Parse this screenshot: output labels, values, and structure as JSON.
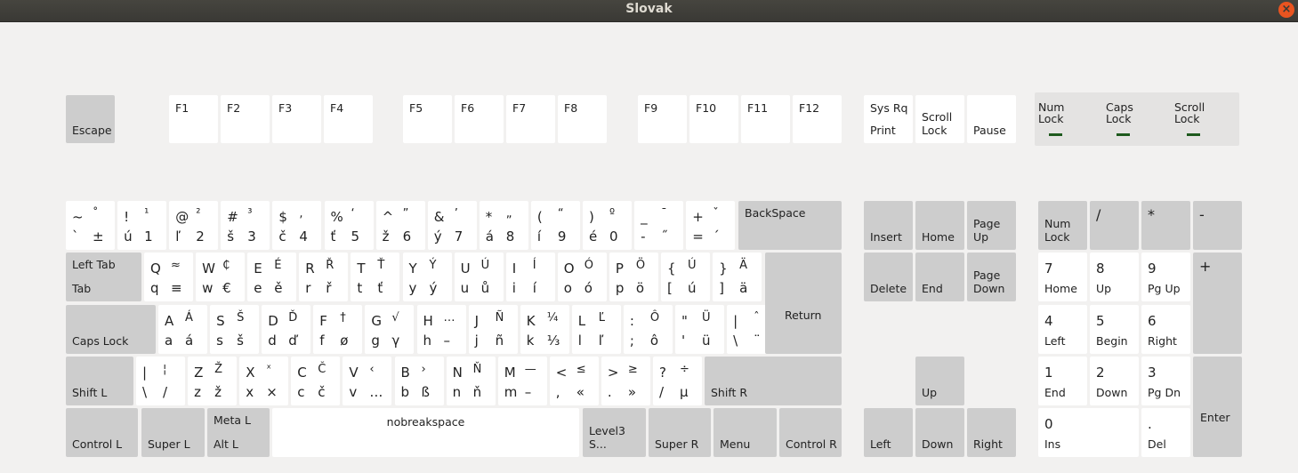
{
  "window": {
    "title": "Slovak",
    "close_glyph": "×"
  },
  "function_row": {
    "escape": "Escape",
    "f": [
      "F1",
      "F2",
      "F3",
      "F4",
      "F5",
      "F6",
      "F7",
      "F8",
      "F9",
      "F10",
      "F11",
      "F12"
    ],
    "sysrq": [
      "Sys Rq",
      "Print"
    ],
    "scroll_lock": "Scroll\nLock",
    "pause": "Pause"
  },
  "indicators": [
    {
      "label": "Num\nLock"
    },
    {
      "label": "Caps\nLock"
    },
    {
      "label": "Scroll\nLock"
    }
  ],
  "number_row": {
    "chars": [
      [
        "~",
        "˚",
        "`",
        "±"
      ],
      [
        "!",
        "¹",
        "ú",
        "1"
      ],
      [
        "@",
        "²",
        "ľ",
        "2"
      ],
      [
        "#",
        "³",
        "š",
        "3"
      ],
      [
        "$",
        ",",
        "č",
        "4"
      ],
      [
        "%",
        "‘",
        "ť",
        "5"
      ],
      [
        "^",
        "”",
        "ž",
        "6"
      ],
      [
        "&",
        "’",
        "ý",
        "7"
      ],
      [
        "*",
        "„",
        "á",
        "8"
      ],
      [
        "(",
        "“",
        "í",
        "9"
      ],
      [
        ")",
        "º",
        "é",
        "0"
      ],
      [
        "_",
        "¯",
        "-",
        "˝"
      ],
      [
        "+",
        "ˇ",
        "=",
        "´"
      ]
    ],
    "backspace": "BackSpace"
  },
  "q_row": {
    "tab": [
      "Left Tab",
      "Tab"
    ],
    "chars": [
      [
        "Q",
        "≈",
        "q",
        "≡"
      ],
      [
        "W",
        "₵",
        "w",
        "€"
      ],
      [
        "E",
        "É",
        "e",
        "ě"
      ],
      [
        "R",
        "Ř",
        "r",
        "ř"
      ],
      [
        "T",
        "Ť",
        "t",
        "ť"
      ],
      [
        "Y",
        "Ý",
        "y",
        "ý"
      ],
      [
        "U",
        "Ú",
        "u",
        "ů"
      ],
      [
        "I",
        "Í",
        "i",
        "í"
      ],
      [
        "O",
        "Ó",
        "o",
        "ó"
      ],
      [
        "P",
        "Ö",
        "p",
        "ö"
      ],
      [
        "{",
        "Ú",
        "[",
        "ú"
      ],
      [
        "}",
        "Ä",
        "]",
        "ä"
      ]
    ],
    "return": "Return"
  },
  "a_row": {
    "caps": "Caps Lock",
    "chars": [
      [
        "A",
        "Á",
        "a",
        "á"
      ],
      [
        "S",
        "Š",
        "s",
        "š"
      ],
      [
        "D",
        "Ď",
        "d",
        "ď"
      ],
      [
        "F",
        "†",
        "f",
        "ø"
      ],
      [
        "G",
        "√",
        "g",
        "γ"
      ],
      [
        "H",
        "…",
        "h",
        "–"
      ],
      [
        "J",
        "Ñ",
        "j",
        "ñ"
      ],
      [
        "K",
        "¼",
        "k",
        "⅓"
      ],
      [
        "L",
        "Ľ",
        "l",
        "ľ"
      ],
      [
        ":",
        "Ô",
        ";",
        "ô"
      ],
      [
        "\"",
        "Ü",
        "'",
        "ü"
      ],
      [
        "|",
        "ˆ",
        "\\",
        "¨"
      ]
    ]
  },
  "z_row": {
    "shift_l": "Shift L",
    "chars": [
      [
        "|",
        "¦",
        "\\",
        "/"
      ],
      [
        "Z",
        "Ž",
        "z",
        "ž"
      ],
      [
        "X",
        "ˣ",
        "x",
        "×"
      ],
      [
        "C",
        "Č",
        "c",
        "č"
      ],
      [
        "V",
        "‹",
        "v",
        "…"
      ],
      [
        "B",
        "›",
        "b",
        "ß"
      ],
      [
        "N",
        "Ň",
        "n",
        "ň"
      ],
      [
        "M",
        "—",
        "m",
        "–"
      ],
      [
        "<",
        "≤",
        ",",
        "«"
      ],
      [
        ">",
        "≥",
        ".",
        "»"
      ],
      [
        "?",
        "÷",
        "/",
        "µ"
      ]
    ],
    "shift_r": "Shift R"
  },
  "bottom_row": {
    "control_l": "Control L",
    "super_l": "Super L",
    "alt": [
      "Meta L",
      "Alt L"
    ],
    "space": "nobreakspace",
    "level3": "Level3 S...",
    "super_r": "Super R",
    "menu": "Menu",
    "control_r": "Control R"
  },
  "nav": {
    "insert": "Insert",
    "home": "Home",
    "page_up": "Page\nUp",
    "delete": "Delete",
    "end": "End",
    "page_down": "Page\nDown",
    "up": "Up",
    "left": "Left",
    "down": "Down",
    "right": "Right"
  },
  "numpad": {
    "num_lock": "Num\nLock",
    "divide": "/",
    "multiply": "*",
    "minus": "-",
    "plus": "+",
    "enter": "Enter",
    "k7": [
      "7",
      "Home"
    ],
    "k8": [
      "8",
      "Up"
    ],
    "k9": [
      "9",
      "Pg Up"
    ],
    "k4": [
      "4",
      "Left"
    ],
    "k5": [
      "5",
      "Begin"
    ],
    "k6": [
      "6",
      "Right"
    ],
    "k1": [
      "1",
      "End"
    ],
    "k2": [
      "2",
      "Down"
    ],
    "k3": [
      "3",
      "Pg Dn"
    ],
    "k0": [
      "0",
      "Ins"
    ],
    "kdot": [
      ".",
      "Del"
    ]
  },
  "colors": {
    "key_white": "#ffffff",
    "key_gray": "#cdcdcd",
    "led_on": "#1e5a1e",
    "close": "#e95420"
  }
}
